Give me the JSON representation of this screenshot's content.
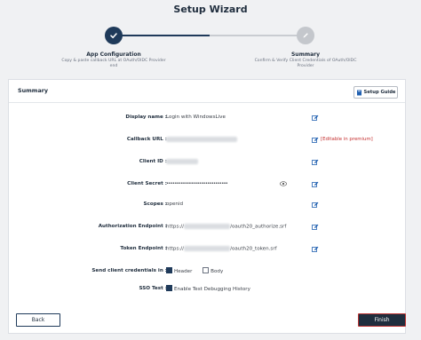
{
  "wizard": {
    "title": "Setup Wizard"
  },
  "steps": [
    {
      "title": "App Configuration",
      "desc_line1": "Copy & paste callback URL at OAuth/OIDC Provider",
      "desc_line2": "end",
      "state": "done",
      "icon": "check-icon"
    },
    {
      "title": "Summary",
      "desc_line1": "Confirm & Verify Client Credentials of OAuth/OIDC",
      "desc_line2": "Provider",
      "state": "pending",
      "icon": "pencil-icon"
    }
  ],
  "card": {
    "title": "Summary",
    "setup_guide_label": "Setup Guide"
  },
  "fields": {
    "display_name": {
      "label": "Display name :",
      "value": "Login with WindowsLive"
    },
    "callback_url": {
      "label": "Callback URL :",
      "premium_text": "[Editable in premium]"
    },
    "client_id": {
      "label": "Client ID :"
    },
    "client_secret": {
      "label": "Client Secret :",
      "value": "••••••••••••••••••••••••••••••"
    },
    "scopes": {
      "label": "Scopes :",
      "value": "openid"
    },
    "auth_endpoint": {
      "label": "Authorization Endpoint :",
      "prefix": "https://",
      "suffix": "/oauth20_authorize.srf"
    },
    "token_endpoint": {
      "label": "Token Endpoint :",
      "prefix": "https://",
      "suffix": "/oauth20_token.srf"
    },
    "send_credentials": {
      "label": "Send client credentials in :",
      "option_header": "Header",
      "option_body": "Body",
      "header_checked": true,
      "body_checked": false
    },
    "sso_test": {
      "label": "SSO Test :",
      "option": "Enable Test Debugging History",
      "checked": true
    }
  },
  "buttons": {
    "back": "Back",
    "finish": "Finish"
  },
  "colors": {
    "primary": "#1f3a5a",
    "premium": "#c53030",
    "edit_icon": "#1f5fb0"
  }
}
